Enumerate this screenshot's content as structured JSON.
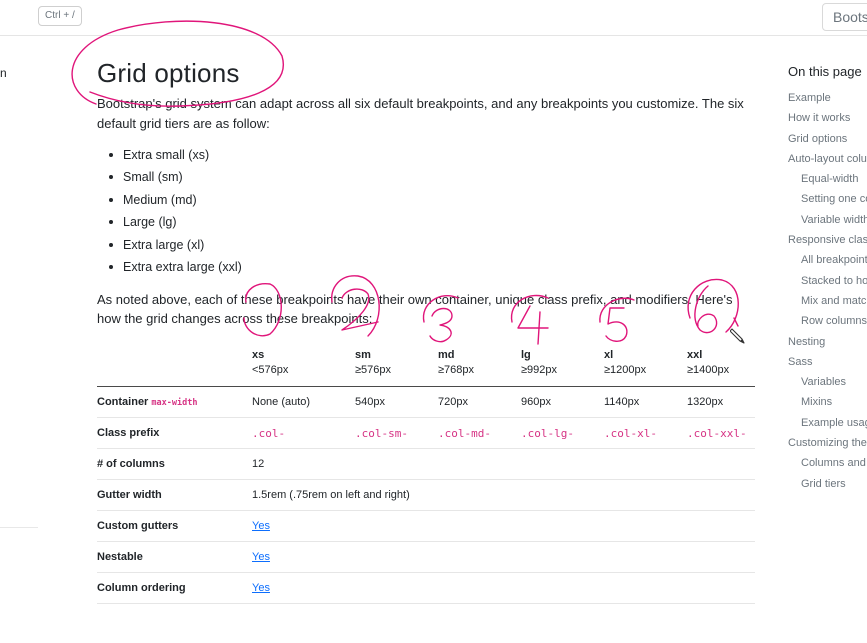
{
  "topbar": {
    "search_shortcut": "Ctrl + /",
    "brand_label": "Bootstrap"
  },
  "left_sidebar": {
    "fragment": "n"
  },
  "main": {
    "title": "Grid options",
    "intro": "Bootstrap's grid system can adapt across all six default breakpoints, and any breakpoints you customize. The six default grid tiers are as follow:",
    "tiers": [
      "Extra small (xs)",
      "Small (sm)",
      "Medium (md)",
      "Large (lg)",
      "Extra large (xl)",
      "Extra extra large (xxl)"
    ],
    "note": "As noted above, each of these breakpoints have their own container, unique class prefix, and modifiers. Here's how the grid changes across these breakpoints:"
  },
  "table": {
    "headers": [
      {
        "tier": "xs",
        "breakpoint": "<576px"
      },
      {
        "tier": "sm",
        "breakpoint": "≥576px"
      },
      {
        "tier": "md",
        "breakpoint": "≥768px"
      },
      {
        "tier": "lg",
        "breakpoint": "≥992px"
      },
      {
        "tier": "xl",
        "breakpoint": "≥1200px"
      },
      {
        "tier": "xxl",
        "breakpoint": "≥1400px"
      }
    ],
    "container": {
      "label": "Container",
      "code": "max-width",
      "values": [
        "None (auto)",
        "540px",
        "720px",
        "960px",
        "1140px",
        "1320px"
      ]
    },
    "class_prefix": {
      "label": "Class prefix",
      "values": [
        ".col-",
        ".col-sm-",
        ".col-md-",
        ".col-lg-",
        ".col-xl-",
        ".col-xxl-"
      ]
    },
    "columns": {
      "label": "# of columns",
      "value": "12"
    },
    "gutter": {
      "label": "Gutter width",
      "value": "1.5rem (.75rem on left and right)"
    },
    "custom_gutters": {
      "label": "Custom gutters",
      "value": "Yes"
    },
    "nestable": {
      "label": "Nestable",
      "value": "Yes"
    },
    "ordering": {
      "label": "Column ordering",
      "value": "Yes"
    }
  },
  "toc": {
    "title": "On this page",
    "items": [
      {
        "label": "Example",
        "sub": false
      },
      {
        "label": "How it works",
        "sub": false
      },
      {
        "label": "Grid options",
        "sub": false
      },
      {
        "label": "Auto-layout columns",
        "sub": false
      },
      {
        "label": "Equal-width",
        "sub": true
      },
      {
        "label": "Setting one column width",
        "sub": true
      },
      {
        "label": "Variable width content",
        "sub": true
      },
      {
        "label": "Responsive classes",
        "sub": false
      },
      {
        "label": "All breakpoints",
        "sub": true
      },
      {
        "label": "Stacked to horizontal",
        "sub": true
      },
      {
        "label": "Mix and match",
        "sub": true
      },
      {
        "label": "Row columns",
        "sub": true
      },
      {
        "label": "Nesting",
        "sub": false
      },
      {
        "label": "Sass",
        "sub": false
      },
      {
        "label": "Variables",
        "sub": true
      },
      {
        "label": "Mixins",
        "sub": true
      },
      {
        "label": "Example usage",
        "sub": true
      },
      {
        "label": "Customizing the grid",
        "sub": false
      },
      {
        "label": "Columns and gutters",
        "sub": true
      },
      {
        "label": "Grid tiers",
        "sub": true
      }
    ]
  },
  "annotations": {
    "color": "#e0157a",
    "numbers": [
      "1",
      "2",
      "3",
      "4",
      "5",
      "6"
    ]
  },
  "icons": {
    "cursor": "pencil-cursor-icon"
  }
}
